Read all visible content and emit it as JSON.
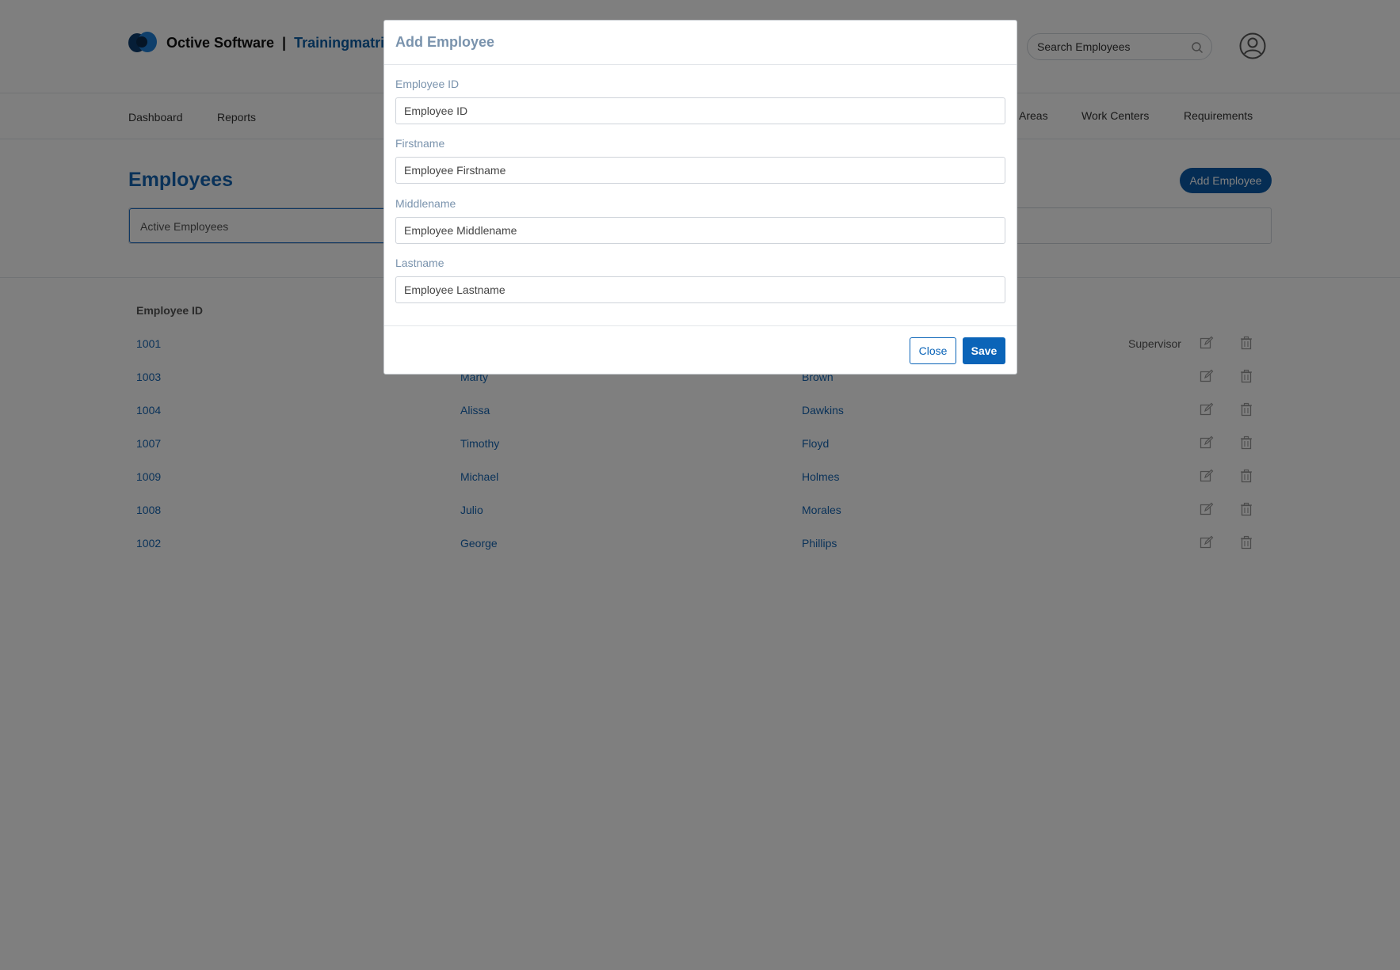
{
  "header": {
    "company": "Octive Software",
    "separator": "|",
    "product": "Trainingmatrix",
    "search_placeholder": "Search Employees",
    "search_icon": "search-icon",
    "avatar_icon": "user-circle-icon"
  },
  "nav": {
    "items": [
      {
        "label": "Dashboard"
      },
      {
        "label": "Reports"
      },
      {
        "label": "Areas"
      },
      {
        "label": "Work Centers"
      },
      {
        "label": "Requirements"
      }
    ]
  },
  "page": {
    "title": "Employees",
    "add_button": "Add Employee",
    "filter_active": "Active Employees"
  },
  "table": {
    "headers": {
      "employee_id": "Employee ID"
    },
    "rows": [
      {
        "id": "1001",
        "first": "",
        "last": "",
        "role": "Supervisor"
      },
      {
        "id": "1003",
        "first": "Marty",
        "last": "Brown",
        "role": ""
      },
      {
        "id": "1004",
        "first": "Alissa",
        "last": "Dawkins",
        "role": ""
      },
      {
        "id": "1007",
        "first": "Timothy",
        "last": "Floyd",
        "role": ""
      },
      {
        "id": "1009",
        "first": "Michael",
        "last": "Holmes",
        "role": ""
      },
      {
        "id": "1008",
        "first": "Julio",
        "last": "Morales",
        "role": ""
      },
      {
        "id": "1002",
        "first": "George",
        "last": "Phillips",
        "role": ""
      }
    ],
    "edit_icon": "edit-icon",
    "delete_icon": "trash-icon"
  },
  "modal": {
    "title": "Add Employee",
    "fields": [
      {
        "label": "Employee ID",
        "placeholder": "Employee ID",
        "value": ""
      },
      {
        "label": "Firstname",
        "placeholder": "Employee Firstname",
        "value": ""
      },
      {
        "label": "Middlename",
        "placeholder": "Employee Middlename",
        "value": ""
      },
      {
        "label": "Lastname",
        "placeholder": "Employee Lastname",
        "value": ""
      }
    ],
    "close_label": "Close",
    "save_label": "Save"
  },
  "colors": {
    "brand_blue": "#0b5ba8",
    "link_blue": "#1565b3",
    "label_muted": "#7a93ad"
  }
}
